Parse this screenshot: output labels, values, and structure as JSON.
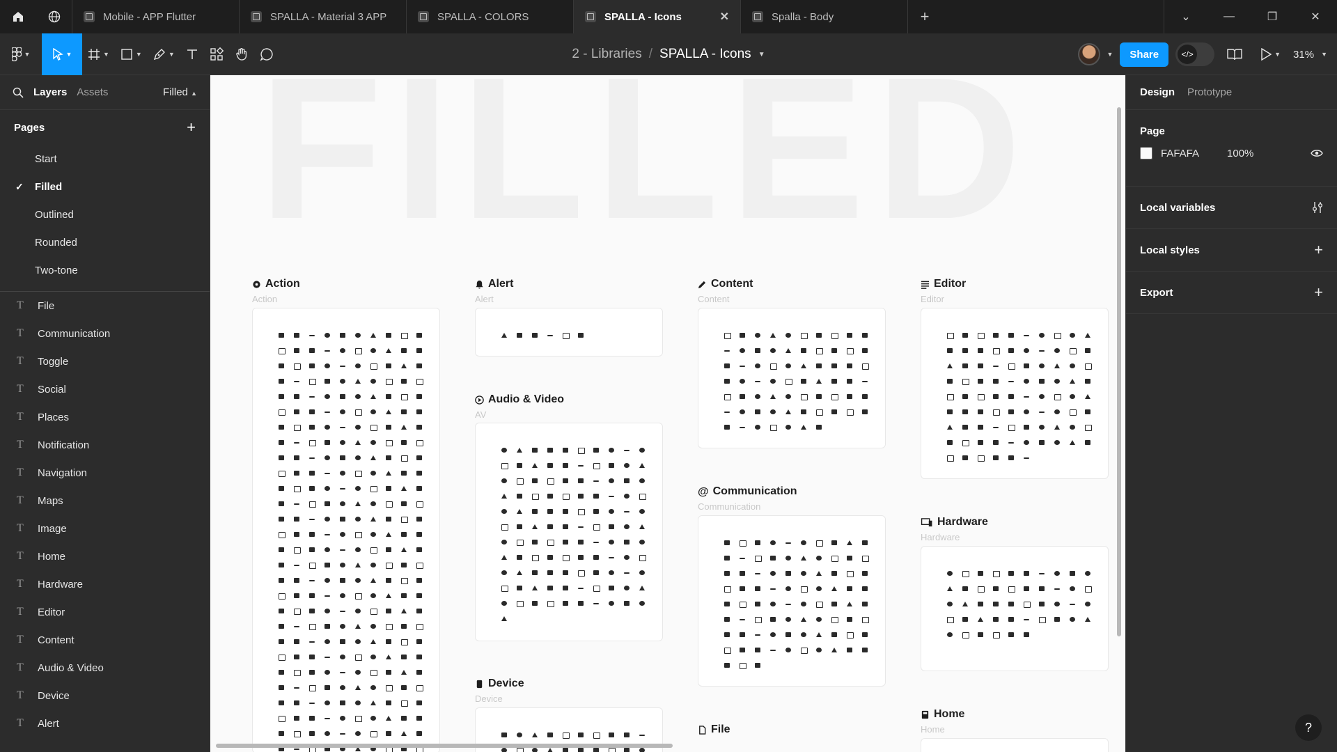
{
  "tabs": [
    {
      "label": "Mobile - APP Flutter",
      "active": false
    },
    {
      "label": "SPALLA - Material 3 APP",
      "active": false
    },
    {
      "label": "SPALLA - COLORS",
      "active": false
    },
    {
      "label": "SPALLA - Icons",
      "active": true
    },
    {
      "label": "Spalla - Body",
      "active": false
    }
  ],
  "breadcrumb": {
    "project": "2 - Libraries",
    "separator": "/",
    "file": "SPALLA - Icons"
  },
  "toolbar": {
    "share_label": "Share",
    "zoom": "31%"
  },
  "left_panel": {
    "tab_layers": "Layers",
    "tab_assets": "Assets",
    "current_page": "Filled",
    "pages_title": "Pages",
    "pages": [
      "Start",
      "Filled",
      "Outlined",
      "Rounded",
      "Two-tone"
    ],
    "layers": [
      "File",
      "Communication",
      "Toggle",
      "Social",
      "Places",
      "Notification",
      "Navigation",
      "Maps",
      "Image",
      "Home",
      "Hardware",
      "Editor",
      "Content",
      "Audio & Video",
      "Device",
      "Alert"
    ]
  },
  "canvas": {
    "watermark": "FILLED",
    "sections": {
      "action": {
        "title": "Action",
        "subtitle": "Action"
      },
      "alert": {
        "title": "Alert",
        "subtitle": "Alert"
      },
      "av": {
        "title": "Audio & Video",
        "subtitle": "AV"
      },
      "device": {
        "title": "Device",
        "subtitle": "Device"
      },
      "content": {
        "title": "Content",
        "subtitle": "Content"
      },
      "communication": {
        "title": "Communication",
        "subtitle": "Communication"
      },
      "file": {
        "title": "File"
      },
      "editor": {
        "title": "Editor",
        "subtitle": "Editor"
      },
      "hardware": {
        "title": "Hardware",
        "subtitle": "Hardware"
      },
      "home": {
        "title": "Home",
        "subtitle": "Home"
      }
    }
  },
  "right_panel": {
    "tab_design": "Design",
    "tab_prototype": "Prototype",
    "page_title": "Page",
    "page_color": "FAFAFA",
    "page_opacity": "100%",
    "local_variables": "Local variables",
    "local_styles": "Local styles",
    "export": "Export"
  },
  "help": "?"
}
